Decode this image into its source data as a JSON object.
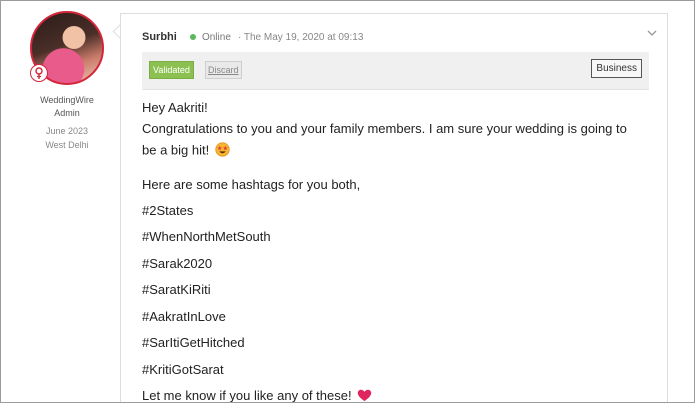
{
  "author": {
    "role_line1": "WeddingWire",
    "role_line2": "Admin",
    "joined": "June 2023",
    "location": "West Delhi",
    "avatar_icon": "profile-photo",
    "badge_icon": "admin-badge-icon"
  },
  "post": {
    "user": "Surbhi",
    "status": "Online",
    "timestamp": "· The May 19, 2020 at 09:13",
    "chevron_icon": "chevron-down-icon",
    "moderation": {
      "validated_label": "Validated",
      "discard_label": "Discard",
      "category_label": "Business"
    },
    "lines": [
      "Hey Aakriti!",
      "Congratulations to you and your family members. I am sure your wedding is going to",
      "be a big hit!",
      "Here are some hashtags for you both,",
      "#2States",
      "#WhenNorthMetSouth",
      "#Sarak2020",
      "#SaratKiRiti",
      "#AakratInLove",
      "#SarItiGetHitched",
      "#KritiGotSarat",
      "Let me know if you like any of these!"
    ],
    "emoji_hit": "star-struck-face-icon",
    "emoji_heart": "red-heart-icon"
  },
  "colors": {
    "accent_red": "#d3263a",
    "online_green": "#5cb85c",
    "validated_green": "#8cc152"
  }
}
